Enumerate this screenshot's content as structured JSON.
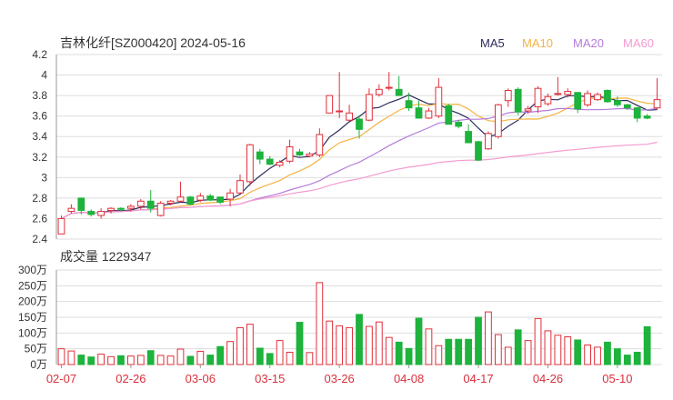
{
  "header": {
    "title": "吉林化纤[SZ000420] 2024-05-16"
  },
  "legend": [
    {
      "label": "MA5",
      "color": "#2b2b5e"
    },
    {
      "label": "MA10",
      "color": "#f5b342"
    },
    {
      "label": "MA20",
      "color": "#b57bdc"
    },
    {
      "label": "MA60",
      "color": "#f39bcf"
    }
  ],
  "volume_panel": {
    "title": "成交量 1229347"
  },
  "colors": {
    "up": "#e0303a",
    "down": "#1db33c",
    "grid": "#dddddd",
    "date_label": "#d9303c"
  },
  "chart_data": {
    "type": "candlestick",
    "title": "吉林化纤[SZ000420] 2024-05-16",
    "price_axis": {
      "ylim": [
        2.4,
        4.2
      ],
      "ticks": [
        "4.2",
        "4",
        "3.8",
        "3.6",
        "3.4",
        "3.2",
        "3",
        "2.8",
        "2.6",
        "2.4"
      ]
    },
    "volume_axis": {
      "ylim": [
        0,
        300
      ],
      "ticks": [
        "300万",
        "250万",
        "200万",
        "150万",
        "100万",
        "50万",
        "0万"
      ]
    },
    "x_ticks": [
      {
        "label": "02-07",
        "index": 0
      },
      {
        "label": "02-26",
        "index": 7
      },
      {
        "label": "03-06",
        "index": 14
      },
      {
        "label": "03-15",
        "index": 21
      },
      {
        "label": "03-26",
        "index": 28
      },
      {
        "label": "04-08",
        "index": 35
      },
      {
        "label": "04-17",
        "index": 42
      },
      {
        "label": "04-26",
        "index": 49
      },
      {
        "label": "05-10",
        "index": 56
      }
    ],
    "ohlc": [
      [
        2.45,
        2.63,
        2.45,
        2.6
      ],
      [
        2.67,
        2.74,
        2.65,
        2.7
      ],
      [
        2.8,
        2.8,
        2.64,
        2.68
      ],
      [
        2.67,
        2.69,
        2.62,
        2.64
      ],
      [
        2.63,
        2.7,
        2.6,
        2.67
      ],
      [
        2.68,
        2.71,
        2.65,
        2.7
      ],
      [
        2.7,
        2.71,
        2.67,
        2.69
      ],
      [
        2.7,
        2.74,
        2.67,
        2.72
      ],
      [
        2.72,
        2.79,
        2.69,
        2.77
      ],
      [
        2.77,
        2.88,
        2.66,
        2.7
      ],
      [
        2.63,
        2.77,
        2.62,
        2.75
      ],
      [
        2.75,
        2.78,
        2.73,
        2.77
      ],
      [
        2.77,
        2.96,
        2.76,
        2.81
      ],
      [
        2.81,
        2.82,
        2.73,
        2.74
      ],
      [
        2.78,
        2.85,
        2.76,
        2.82
      ],
      [
        2.82,
        2.84,
        2.77,
        2.78
      ],
      [
        2.81,
        2.77,
        2.74,
        2.76
      ],
      [
        2.79,
        2.89,
        2.72,
        2.85
      ],
      [
        2.85,
        3.03,
        2.84,
        2.97
      ],
      [
        2.96,
        3.33,
        2.92,
        3.32
      ],
      [
        3.25,
        3.28,
        3.13,
        3.18
      ],
      [
        3.18,
        3.21,
        3.12,
        3.13
      ],
      [
        3.12,
        3.17,
        3.1,
        3.15
      ],
      [
        3.16,
        3.37,
        3.14,
        3.3
      ],
      [
        3.25,
        3.28,
        3.21,
        3.22
      ],
      [
        3.21,
        3.25,
        3.2,
        3.23
      ],
      [
        3.22,
        3.48,
        3.2,
        3.42
      ],
      [
        3.63,
        3.8,
        3.63,
        3.8
      ],
      [
        3.65,
        4.03,
        3.58,
        3.65
      ],
      [
        3.56,
        3.71,
        3.55,
        3.63
      ],
      [
        3.57,
        3.61,
        3.38,
        3.47
      ],
      [
        3.56,
        3.87,
        3.55,
        3.81
      ],
      [
        3.81,
        3.91,
        3.79,
        3.86
      ],
      [
        3.88,
        4.03,
        3.85,
        3.88
      ],
      [
        3.86,
        3.99,
        3.82,
        3.8
      ],
      [
        3.75,
        3.83,
        3.65,
        3.68
      ],
      [
        3.68,
        3.75,
        3.58,
        3.58
      ],
      [
        3.58,
        3.68,
        3.57,
        3.65
      ],
      [
        3.6,
        3.97,
        3.58,
        3.88
      ],
      [
        3.7,
        3.72,
        3.52,
        3.52
      ],
      [
        3.54,
        3.56,
        3.48,
        3.5
      ],
      [
        3.45,
        3.52,
        3.34,
        3.34
      ],
      [
        3.35,
        3.36,
        3.16,
        3.17
      ],
      [
        3.28,
        3.45,
        3.27,
        3.43
      ],
      [
        3.4,
        3.72,
        3.38,
        3.71
      ],
      [
        3.75,
        3.87,
        3.69,
        3.85
      ],
      [
        3.86,
        3.88,
        3.61,
        3.64
      ],
      [
        3.65,
        3.7,
        3.62,
        3.67
      ],
      [
        3.69,
        3.89,
        3.63,
        3.87
      ],
      [
        3.72,
        3.82,
        3.7,
        3.79
      ],
      [
        3.82,
        3.98,
        3.8,
        3.82
      ],
      [
        3.81,
        3.87,
        3.78,
        3.84
      ],
      [
        3.83,
        3.83,
        3.63,
        3.67
      ],
      [
        3.71,
        3.85,
        3.69,
        3.82
      ],
      [
        3.76,
        3.83,
        3.75,
        3.81
      ],
      [
        3.85,
        3.86,
        3.73,
        3.74
      ],
      [
        3.75,
        3.79,
        3.69,
        3.71
      ],
      [
        3.71,
        3.72,
        3.66,
        3.68
      ],
      [
        3.68,
        3.69,
        3.54,
        3.58
      ],
      [
        3.6,
        3.62,
        3.57,
        3.58
      ],
      [
        3.68,
        3.97,
        3.66,
        3.76
      ]
    ],
    "volume": [
      50,
      43,
      30,
      24,
      33,
      25,
      28,
      27,
      29,
      44,
      29,
      27,
      49,
      26,
      42,
      30,
      57,
      73,
      117,
      128,
      52,
      35,
      76,
      39,
      134,
      38,
      260,
      138,
      123,
      117,
      159,
      121,
      135,
      86,
      71,
      51,
      147,
      113,
      60,
      80,
      80,
      80,
      150,
      167,
      95,
      55,
      110,
      76,
      146,
      107,
      93,
      88,
      78,
      62,
      55,
      71,
      50,
      30,
      39,
      120
    ]
  }
}
